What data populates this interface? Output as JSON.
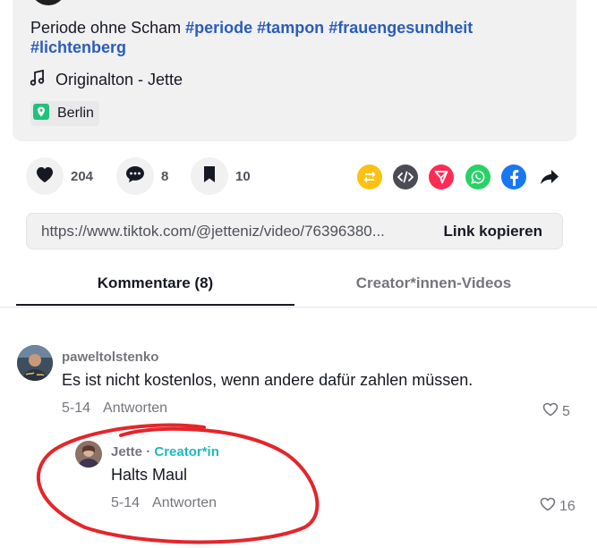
{
  "description": {
    "text": "Periode ohne Scham",
    "hashtags": [
      "#periode",
      "#tampon",
      "#frauengesundheit",
      "#lichtenberg"
    ],
    "music": "Originalton - Jette",
    "location": "Berlin"
  },
  "actions": {
    "likes": "204",
    "comments": "8",
    "saves": "10"
  },
  "share_icons": [
    "repost-icon",
    "embed-icon",
    "send-to-friends-icon",
    "whatsapp-icon",
    "facebook-icon",
    "share-arrow-icon"
  ],
  "link": {
    "url": "https://www.tiktok.com/@jetteniz/video/76396380...",
    "copy_label": "Link kopieren"
  },
  "tabs": {
    "comments": "Kommentare (8)",
    "creator_videos": "Creator*innen-Videos"
  },
  "comments": [
    {
      "username": "paweltolstenko",
      "text": "Es ist nicht kostenlos, wenn andere dafür zahlen müssen.",
      "date": "5-14",
      "reply_label": "Antworten",
      "likes": "5"
    }
  ],
  "reply": {
    "username": "Jette",
    "separator": "·",
    "badge": "Creator*in",
    "text": "Halts Maul",
    "date": "5-14",
    "reply_label": "Antworten",
    "likes": "16"
  },
  "colors": {
    "hashtag": "#2b5db9",
    "creator_badge": "#20b8c0",
    "annotation": "#e3262b",
    "location_icon": "#1ec27a"
  }
}
